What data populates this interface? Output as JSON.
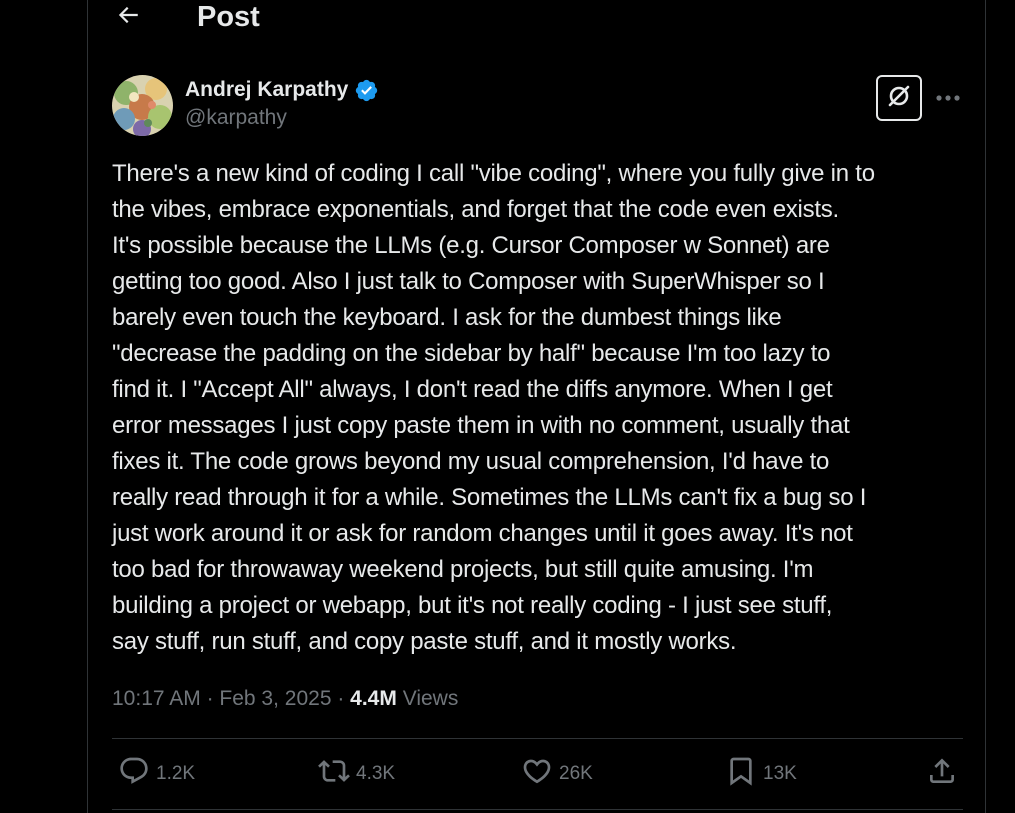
{
  "header": {
    "title": "Post"
  },
  "author": {
    "name": "Andrej Karpathy",
    "handle": "@karpathy"
  },
  "post": {
    "text": "There's a new kind of coding I call \"vibe coding\", where you fully give in to\nthe vibes, embrace exponentials, and forget that the code even exists.\nIt's possible because the LLMs (e.g. Cursor Composer w Sonnet) are\ngetting too good. Also I just talk to Composer with SuperWhisper so I\nbarely even touch the keyboard. I ask for the dumbest things like\n\"decrease the padding on the sidebar by half\" because I'm too lazy to\nfind it. I \"Accept All\" always, I don't read the diffs anymore. When I get\nerror messages I just copy paste them in with no comment, usually that\nfixes it. The code grows beyond my usual comprehension, I'd have to\nreally read through it for a while. Sometimes the LLMs can't fix a bug so I\njust work around it or ask for random changes until it goes away. It's not\ntoo bad for throwaway weekend projects, but still quite amusing. I'm\nbuilding a project or webapp, but it's not really coding - I just see stuff,\nsay stuff, run stuff, and copy paste stuff, and it mostly works."
  },
  "meta": {
    "time": "10:17 AM",
    "separator": " · ",
    "date": "Feb 3, 2025",
    "views_count": "4.4M",
    "views_label": " Views"
  },
  "actions": {
    "replies": "1.2K",
    "reposts": "4.3K",
    "likes": "26K",
    "bookmarks": "13K"
  },
  "icons": {
    "back": "arrow-left-icon",
    "verified": "verified-badge-icon",
    "grok": "grok-icon",
    "more": "more-dots-icon",
    "reply": "reply-icon",
    "repost": "repost-icon",
    "like": "heart-icon",
    "bookmark": "bookmark-icon",
    "share": "share-icon"
  },
  "colors": {
    "background": "#000000",
    "text": "#e7e9ea",
    "secondary": "#71767b",
    "divider": "#2f3336",
    "verified": "#1d9bf0"
  }
}
